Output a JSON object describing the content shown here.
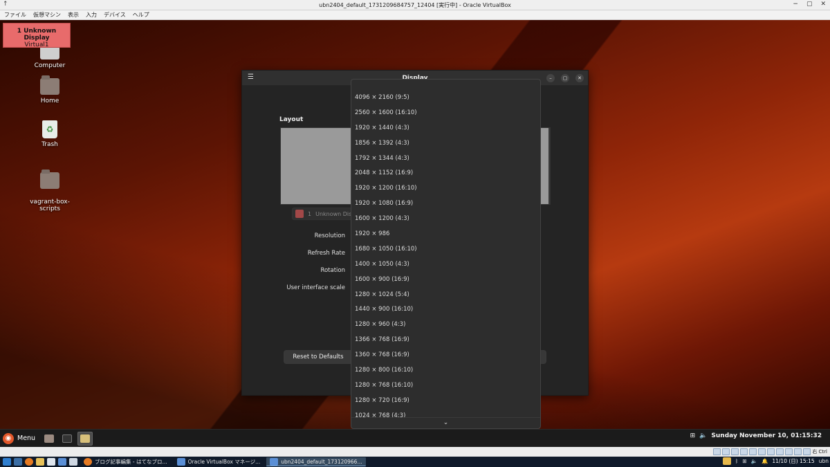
{
  "host_window": {
    "title": "ubn2404_default_1731209684757_12404 [実行中] - Oracle VirtualBox",
    "menu": [
      "ファイル",
      "仮想マシン",
      "表示",
      "入力",
      "デバイス",
      "ヘルプ"
    ]
  },
  "desktop": {
    "icons": [
      {
        "label": "Computer",
        "icon": "computer-icon"
      },
      {
        "label": "Home",
        "icon": "home-folder-icon"
      },
      {
        "label": "Trash",
        "icon": "trash-icon"
      },
      {
        "label": "vagrant-box-\nscripts",
        "icon": "folder-icon"
      }
    ],
    "osd": {
      "line1": "1 Unknown Display",
      "line2": "Virtual1"
    }
  },
  "display_window": {
    "title": "Display",
    "layout_label": "Layout",
    "monitor_chip": {
      "number": "1",
      "name": "Unknown Dis"
    },
    "settings": {
      "resolution": "Resolution",
      "refresh_rate": "Refresh Rate",
      "rotation": "Rotation",
      "ui_scale": "User interface scale"
    },
    "reset_button": "Reset to Defaults"
  },
  "resolution_dropdown": {
    "items": [
      "4096 × 2160 (9:5)",
      "2560 × 1600 (16:10)",
      "1920 × 1440 (4:3)",
      "1856 × 1392 (4:3)",
      "1792 × 1344 (4:3)",
      "2048 × 1152 (16:9)",
      "1920 × 1200 (16:10)",
      "1920 × 1080 (16:9)",
      "1600 × 1200 (4:3)",
      "1920 × 986",
      "1680 × 1050 (16:10)",
      "1400 × 1050 (4:3)",
      "1600 × 900 (16:9)",
      "1280 × 1024 (5:4)",
      "1440 × 900 (16:10)",
      "1280 × 960 (4:3)",
      "1366 × 768 (16:9)",
      "1360 × 768 (16:9)",
      "1280 × 800 (16:10)",
      "1280 × 768 (16:10)",
      "1280 × 720 (16:9)",
      "1024 × 768 (4:3)"
    ],
    "scroll_down_icon": "chevron-down-icon"
  },
  "guest_panel": {
    "menu_label": "Menu",
    "clock": "Sunday November 10, 01:15:32"
  },
  "vbox_status": {
    "host_key": "右 Ctrl"
  },
  "host_taskbar": {
    "tasks": [
      {
        "label": "ブログ記事編集 - はてなブロ..."
      },
      {
        "label": "Oracle VirtualBox マネージ..."
      },
      {
        "label": "ubn2404_default_173120966..."
      }
    ],
    "clock": "11/10 (日) 15:15",
    "user": "ubn"
  },
  "colors": {
    "osd_bg": "#e86b6b",
    "monitor_swatch": "#a24848",
    "ubuntu_orange": "#e2572a"
  }
}
